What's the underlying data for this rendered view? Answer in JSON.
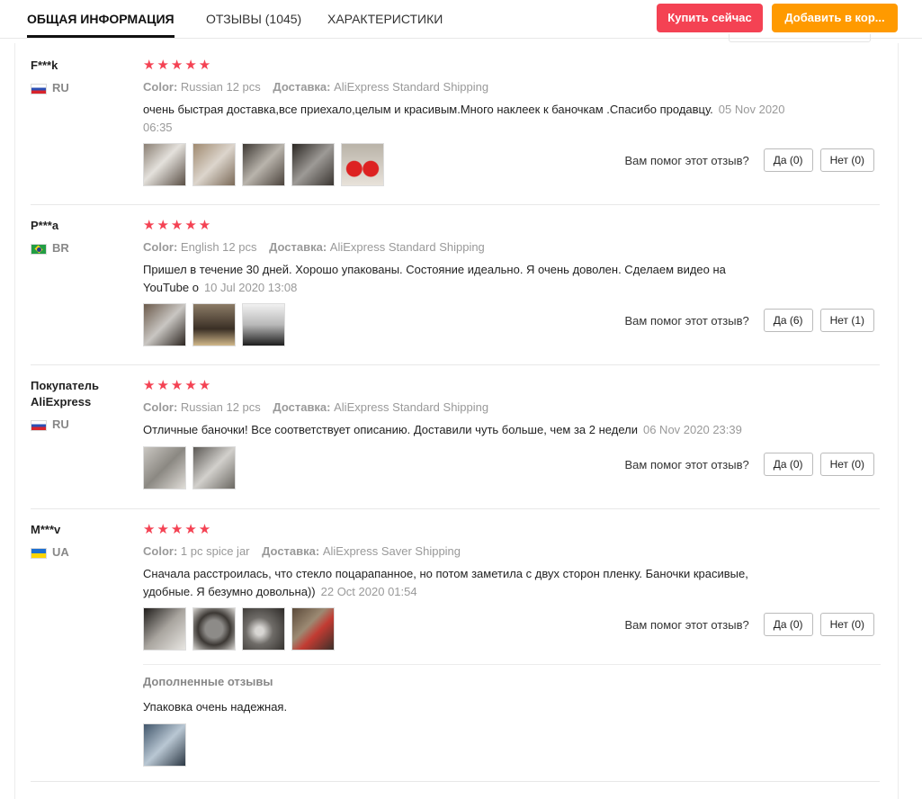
{
  "tabs": [
    {
      "label": "ОБЩАЯ ИНФОРМАЦИЯ",
      "active": true
    },
    {
      "label": "ОТЗЫВЫ (1045)",
      "active": false
    },
    {
      "label": "ХАРАКТЕРИСТИКИ",
      "active": false
    }
  ],
  "actions": {
    "buy_now": "Купить сейчас",
    "add_to_cart": "Добавить в кор..."
  },
  "labels": {
    "color": "Color:",
    "delivery": "Доставка:",
    "helpful_q": "Вам помог этот отзыв?",
    "additional_reviews": "Дополненные отзывы"
  },
  "colors": {
    "buy_button": "#f44253",
    "cart_button": "#ff9a00",
    "stars": "#f44253"
  },
  "reviews": [
    {
      "user": "F***k",
      "country": "RU",
      "stars": "★★★★★",
      "rating": 5,
      "color_value": "Russian 12 pcs",
      "delivery_value": "AliExpress Standard Shipping",
      "text": "очень быстрая доставка,все приехало,целым и красивым.Много наклеек к баночкам .Спасибо продавцу.",
      "date": "05 Nov 2020 06:35",
      "yes": "Да (0)",
      "no": "Нет (0)",
      "photo_count": 5
    },
    {
      "user": "P***a",
      "country": "BR",
      "stars": "★★★★★",
      "rating": 5,
      "color_value": "English 12 pcs",
      "delivery_value": "AliExpress Standard Shipping",
      "text": "Пришел в течение 30 дней. Хорошо упакованы. Состояние идеально. Я очень доволен. Сделаем видео на YouTube о",
      "date": "10 Jul 2020 13:08",
      "yes": "Да (6)",
      "no": "Нет (1)",
      "photo_count": 3
    },
    {
      "user": "Покупатель AliExpress",
      "country": "RU",
      "stars": "★★★★★",
      "rating": 5,
      "color_value": "Russian 12 pcs",
      "delivery_value": "AliExpress Standard Shipping",
      "text": "Отличные баночки! Все соответствует описанию. Доставили чуть больше, чем за 2 недели",
      "date": "06 Nov 2020 23:39",
      "yes": "Да (0)",
      "no": "Нет (0)",
      "photo_count": 2
    },
    {
      "user": "M***v",
      "country": "UA",
      "stars": "★★★★★",
      "rating": 5,
      "color_value": "1 pc spice jar",
      "delivery_value": "AliExpress Saver Shipping",
      "text": "Сначала расстроилась, что стекло поцарапанное, но потом заметила с двух сторон пленку. Баночки красивые, удобные. Я безумно довольна))",
      "date": "22 Oct 2020 01:54",
      "yes": "Да (0)",
      "no": "Нет (0)",
      "photo_count": 4,
      "additional_text": "Упаковка очень надежная.",
      "additional_photo_count": 1
    }
  ]
}
